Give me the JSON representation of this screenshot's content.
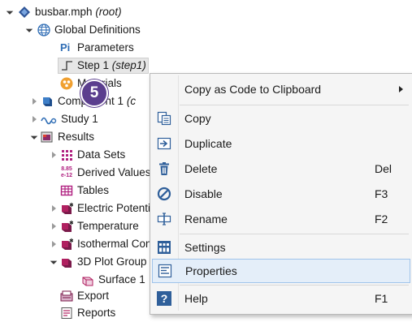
{
  "tree": {
    "root_label": "busbar.mph",
    "root_suffix": "(root)",
    "global_definitions": "Global Definitions",
    "parameters": "Parameters",
    "step_label": "Step 1",
    "step_tag": "(step1)",
    "materials_label": "Materials",
    "component_label": "Component 1",
    "component_tag": "(c",
    "study_label": "Study 1",
    "results_label": "Results",
    "data_sets": "Data Sets",
    "derived_values": "Derived Values",
    "tables": "Tables",
    "electric_potential": "Electric Potential",
    "temperature": "Temperature",
    "isothermal": "Isothermal Contours",
    "plot_group_3d": "3D Plot Group",
    "surface": "Surface 1",
    "export": "Export",
    "reports": "Reports",
    "parameters_icon_text": "Pi",
    "derived_icon_top": "8.85",
    "derived_icon_bottom": "e-12"
  },
  "badge": {
    "number": "5"
  },
  "context_menu": {
    "copy_as_code": "Copy as Code to Clipboard",
    "copy": "Copy",
    "duplicate": "Duplicate",
    "delete": "Delete",
    "delete_shortcut": "Del",
    "disable": "Disable",
    "disable_shortcut": "F3",
    "rename": "Rename",
    "rename_shortcut": "F2",
    "settings": "Settings",
    "properties": "Properties",
    "help": "Help",
    "help_shortcut": "F1",
    "help_icon_text": "?"
  },
  "colors": {
    "badge": "#5b3e8e",
    "hover_bg": "#e4eef9",
    "hover_border": "#9fc3ea",
    "menu_bg": "#f5f5f5"
  },
  "icons": {
    "root": "model-diamond-icon",
    "global_definitions": "globe-icon",
    "parameters": "pi-icon",
    "step": "step-function-icon",
    "materials": "materials-icon",
    "component": "cube-icon",
    "study": "study-icon",
    "results": "results-icon",
    "help": "help-icon"
  }
}
